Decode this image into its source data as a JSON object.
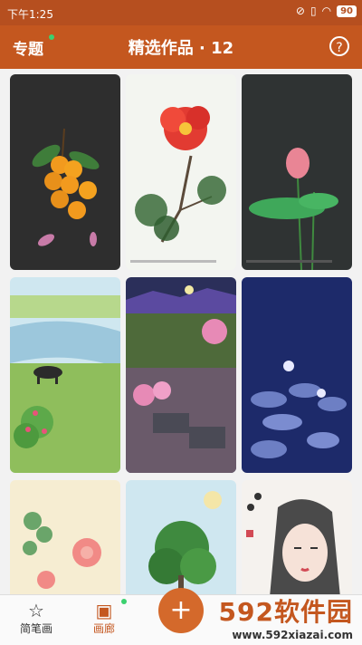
{
  "status": {
    "time": "下午1:25",
    "battery": "90"
  },
  "header": {
    "left": "专题",
    "title": "精选作品 · 12"
  },
  "gallery": [
    {
      "name": "artwork-oranges"
    },
    {
      "name": "artwork-peony-pine"
    },
    {
      "name": "artwork-lotus-bud"
    },
    {
      "name": "artwork-river-buffalo"
    },
    {
      "name": "artwork-village-blossoms"
    },
    {
      "name": "artwork-night-lotus"
    },
    {
      "name": "artwork-pink-flowers"
    },
    {
      "name": "artwork-tree-sun"
    },
    {
      "name": "artwork-woman-portrait"
    }
  ],
  "tabs": [
    {
      "label": "简笔画",
      "icon": "star-icon"
    },
    {
      "label": "画廊",
      "icon": "gallery-icon"
    }
  ],
  "fab": {
    "icon": "plus-icon"
  },
  "watermark": {
    "big": "592软件园",
    "small": "www.592xiazai.com"
  },
  "colors": {
    "accent": "#c4571f",
    "statusbar": "#b64f1f",
    "dot": "#3bd16f"
  }
}
